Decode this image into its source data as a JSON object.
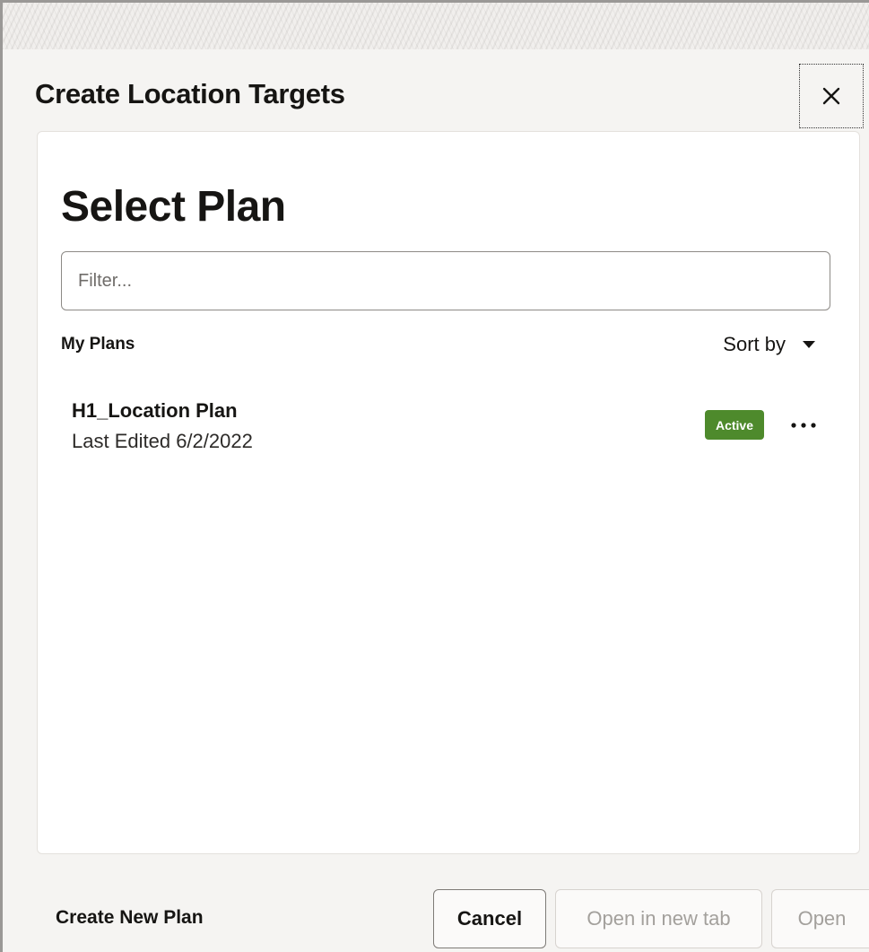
{
  "dialog": {
    "title": "Create Location Targets",
    "close_icon": "close-icon"
  },
  "panel": {
    "title": "Select Plan",
    "filter": {
      "placeholder": "Filter...",
      "value": ""
    },
    "section_label": "My Plans",
    "sort": {
      "label": "Sort by",
      "icon": "caret-down-icon"
    },
    "plans": [
      {
        "name": "H1_Location Plan",
        "meta": "Last Edited 6/2/2022",
        "status": "Active",
        "status_color": "#4e8a2c",
        "menu_icon": "more-horizontal-icon"
      }
    ]
  },
  "footer": {
    "create_link": "Create New Plan",
    "cancel_label": "Cancel",
    "open_new_tab_label": "Open in new tab",
    "open_label": "Open"
  }
}
